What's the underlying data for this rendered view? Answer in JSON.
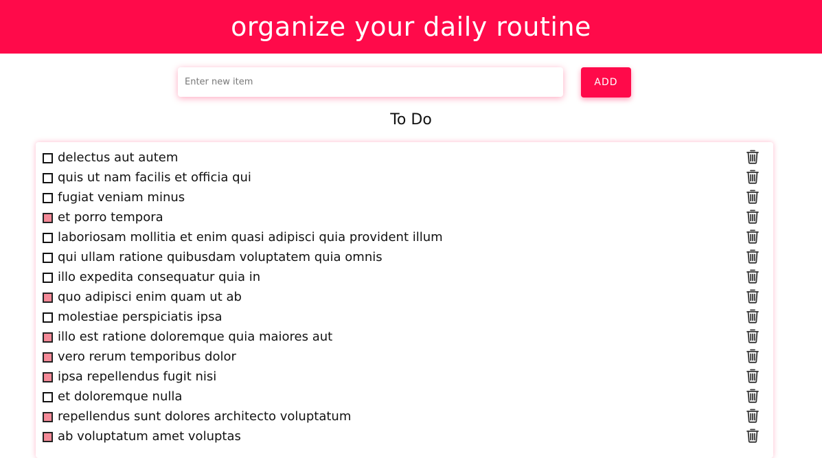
{
  "header": {
    "title": "organize your daily routine"
  },
  "form": {
    "input_value": "",
    "input_placeholder": "Enter new item",
    "add_label": "ADD"
  },
  "section": {
    "title": "To Do"
  },
  "colors": {
    "accent": "#ff0a4a",
    "checked_fill": "#f48a98"
  },
  "items": [
    {
      "label": "delectus aut autem",
      "checked": false
    },
    {
      "label": "quis ut nam facilis et officia qui",
      "checked": false
    },
    {
      "label": "fugiat veniam minus",
      "checked": false
    },
    {
      "label": "et porro tempora",
      "checked": true
    },
    {
      "label": "laboriosam mollitia et enim quasi adipisci quia provident illum",
      "checked": false
    },
    {
      "label": "qui ullam ratione quibusdam voluptatem quia omnis",
      "checked": false
    },
    {
      "label": "illo expedita consequatur quia in",
      "checked": false
    },
    {
      "label": "quo adipisci enim quam ut ab",
      "checked": true
    },
    {
      "label": "molestiae perspiciatis ipsa",
      "checked": false
    },
    {
      "label": "illo est ratione doloremque quia maiores aut",
      "checked": true
    },
    {
      "label": "vero rerum temporibus dolor",
      "checked": true
    },
    {
      "label": "ipsa repellendus fugit nisi",
      "checked": true
    },
    {
      "label": "et doloremque nulla",
      "checked": false
    },
    {
      "label": "repellendus sunt dolores architecto voluptatum",
      "checked": true
    },
    {
      "label": "ab voluptatum amet voluptas",
      "checked": true
    }
  ]
}
